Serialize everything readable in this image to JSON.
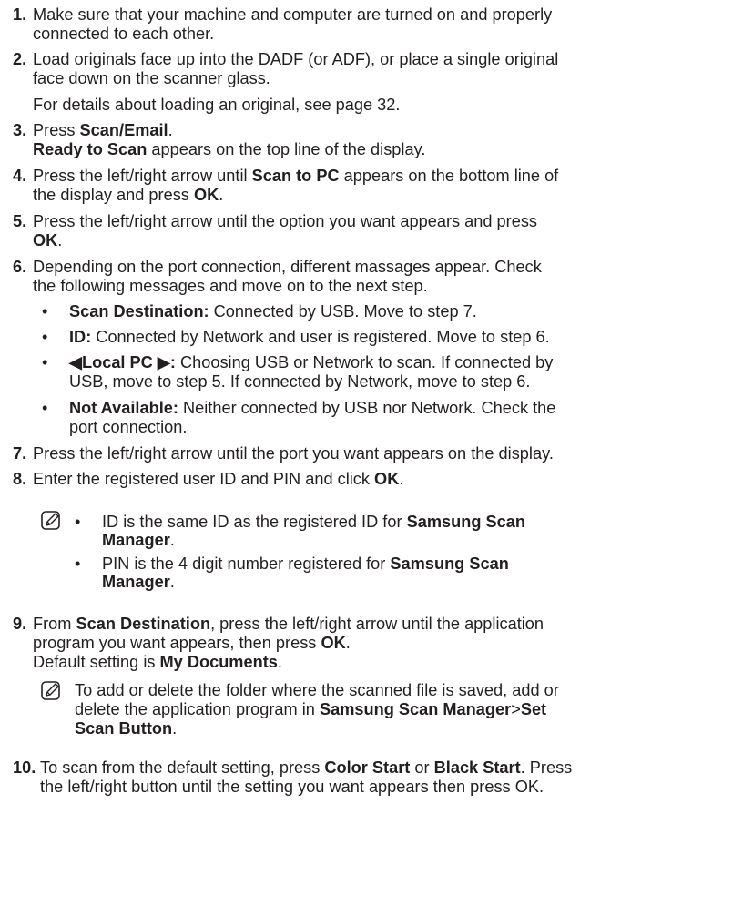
{
  "steps": [
    {
      "num": "1.",
      "lines": [
        [
          "Make sure that your machine and computer are turned on and properly"
        ],
        [
          "connected to each other."
        ]
      ]
    },
    {
      "num": "2.",
      "lines": [
        [
          "Load originals face up into the DADF (or ADF), or place a single original"
        ],
        [
          "face down on the scanner glass."
        ],
        [
          "For details about loading an original, see page 32."
        ]
      ]
    },
    {
      "num": "3.",
      "lines": [
        [
          "Press ",
          "Scan/Email",
          "."
        ],
        [
          "",
          "Ready to Scan",
          " appears on the top line of the display."
        ]
      ]
    },
    {
      "num": "4.",
      "lines": [
        [
          "Press the left/right arrow until ",
          "Scan to PC",
          " appears on the bottom line of"
        ],
        [
          "the display and press ",
          "OK",
          "."
        ]
      ]
    },
    {
      "num": "5.",
      "lines": [
        [
          "Press the left/right arrow until the option you want appears and press"
        ],
        [
          "",
          "OK",
          "."
        ]
      ]
    },
    {
      "num": "6.",
      "lines": [
        [
          "Depending on the port connection, different massages appear. Check"
        ],
        [
          "the following messages and move on to the next step."
        ]
      ]
    },
    {
      "num": "7.",
      "lines": [
        [
          "Press the left/right arrow until the port you want appears on the display."
        ]
      ]
    },
    {
      "num": "8.",
      "lines": [
        [
          "Enter the registered user ID and PIN and click ",
          "OK",
          "."
        ]
      ]
    },
    {
      "num": "9.",
      "lines": [
        [
          "From ",
          "Scan Destination",
          ", press the left/right arrow until the application"
        ],
        [
          "program you want appears, then press ",
          "OK",
          "."
        ],
        [
          "Default setting is ",
          "My Documents",
          "."
        ]
      ]
    },
    {
      "num": "10.",
      "lines": [
        [
          "To scan from the default setting, press ",
          "Color Start",
          " or ",
          "Black Start",
          ". Press"
        ],
        [
          "the left/right button until the setting you want appears then press OK."
        ]
      ]
    }
  ],
  "step6_bullets": [
    {
      "lines": [
        [
          "",
          "Scan Destination:",
          "  Connected by USB. Move to step 7."
        ]
      ]
    },
    {
      "lines": [
        [
          "",
          "ID:",
          "  Connected by Network and user is registered. Move to step 6."
        ]
      ]
    },
    {
      "lines": [
        [
          "",
          "◀Local PC ▶:",
          "  Choosing USB or Network to scan. If connected by"
        ],
        [
          "USB, move to step 5. If connected by Network, move to step 6."
        ]
      ]
    },
    {
      "lines": [
        [
          "",
          "Not Available:",
          "  Neither connected by USB nor Network. Check the"
        ],
        [
          "port connection."
        ]
      ]
    }
  ],
  "step8_note": [
    {
      "lines": [
        [
          "ID is the same ID as the registered ID for ",
          "Samsung Scan"
        ],
        [
          "",
          "Manager",
          "."
        ]
      ]
    },
    {
      "lines": [
        [
          "PIN is the 4 digit number registered for ",
          "Samsung Scan"
        ],
        [
          "",
          "Manager",
          "."
        ]
      ]
    }
  ],
  "step9_note": {
    "lines": [
      [
        "To add or delete the folder where the scanned file is saved, add or"
      ],
      [
        "delete the application program in ",
        "Samsung Scan Manager",
        ">",
        "Set"
      ],
      [
        "",
        "Scan Button",
        "."
      ]
    ]
  },
  "bullet_glyph": "•",
  "icons": {
    "note": "note-pencil-icon"
  }
}
